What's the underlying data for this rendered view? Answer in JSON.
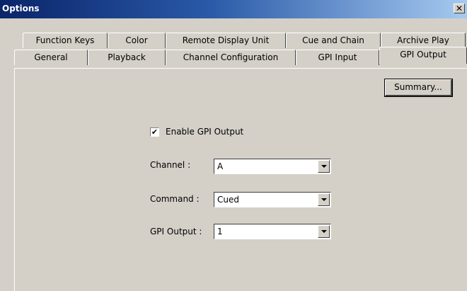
{
  "window": {
    "title": "Options",
    "close_glyph": "✕"
  },
  "tabs": {
    "row1": [
      "Function Keys",
      "Color",
      "Remote Display Unit",
      "Cue and Chain",
      "Archive Play"
    ],
    "row2": [
      "General",
      "Playback",
      "Channel Configuration",
      "GPI Input",
      "GPI Output"
    ],
    "active": "GPI Output"
  },
  "panel": {
    "summary_label": "Summary...",
    "enable_label": "Enable GPI Output",
    "enable_checked": true,
    "check_glyph": "✔",
    "fields": [
      {
        "label": "Channel :",
        "value": "A"
      },
      {
        "label": "Command :",
        "value": "Cued"
      },
      {
        "label": "GPI Output :",
        "value": "1"
      }
    ]
  }
}
